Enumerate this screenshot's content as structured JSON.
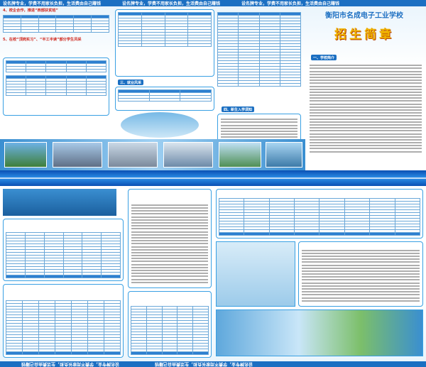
{
  "top_bar": [
    "设名牌专业，学费不用家长负担，生活费由自己赚钱",
    "设名牌专业，学费不用家长负担，生活费由自己赚钱",
    "设名牌专业，学费不用家长负担，生活费由自己赚钱"
  ],
  "section4": {
    "title": "4、校企合作，推进“西部扶贫班”"
  },
  "section5": {
    "title": "5、在校“顶岗实习”、“半工半读”部分学生风采"
  },
  "school": {
    "name": "衡阳市名成电子工业学校",
    "slogan": "招生简章"
  },
  "labels": {
    "intro": "一、学校简介",
    "employment": "三、就业风采",
    "newstudent": "四、新生入学须知"
  },
  "colors": {
    "banner": "#1b6fc2",
    "heading": "#d0281e",
    "accent": "#39a0e3",
    "slogan": "#f0b400"
  }
}
